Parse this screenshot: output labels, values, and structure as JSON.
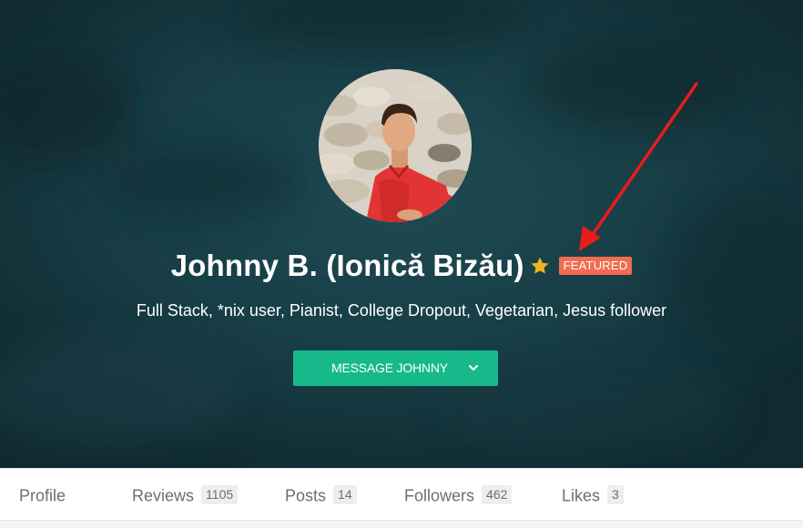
{
  "profile": {
    "name": "Johnny B. (Ionică Bizău)",
    "featured_badge": "FEATURED",
    "tagline": "Full Stack, *nix user, Pianist, College Dropout, Vegetarian, Jesus follower",
    "message_button": "MESSAGE JOHNNY",
    "avatar_icon": "avatar",
    "star_icon": "star-icon"
  },
  "tabs": [
    {
      "label": "Profile",
      "count": null
    },
    {
      "label": "Reviews",
      "count": "1105"
    },
    {
      "label": "Posts",
      "count": "14"
    },
    {
      "label": "Followers",
      "count": "462"
    },
    {
      "label": "Likes",
      "count": "3"
    }
  ],
  "colors": {
    "hero_background": "#14343c",
    "button_green": "#17b98a",
    "featured_orange": "#f26c4f",
    "star_gold": "#f2b51f",
    "annotation_arrow": "#e81c1c"
  }
}
